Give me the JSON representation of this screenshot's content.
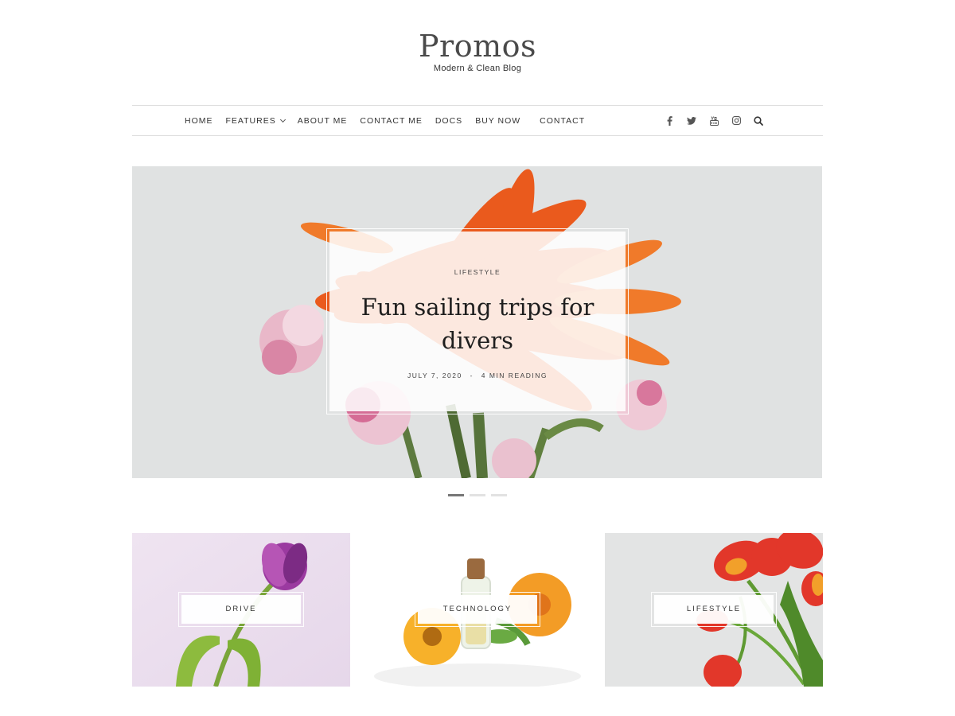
{
  "site": {
    "title": "Promos",
    "tagline": "Modern & Clean Blog"
  },
  "nav": {
    "items": [
      {
        "label": "HOME"
      },
      {
        "label": "FEATURES"
      },
      {
        "label": "ABOUT ME"
      },
      {
        "label": "CONTACT ME"
      },
      {
        "label": "DOCS"
      },
      {
        "label": "BUY NOW"
      },
      {
        "label": "CONTACT"
      }
    ],
    "social_icons": [
      "facebook-icon",
      "twitter-icon",
      "youtube-icon",
      "instagram-icon",
      "search-icon"
    ]
  },
  "hero": {
    "category": "LIFESTYLE",
    "title": "Fun sailing trips for divers",
    "date": "JULY 7, 2020",
    "separator": "-",
    "reading": "4 MIN READING",
    "slides_total": 3,
    "active_slide": 1
  },
  "categories": [
    {
      "label": "DRIVE"
    },
    {
      "label": "TECHNOLOGY"
    },
    {
      "label": "LIFESTYLE"
    }
  ],
  "colors": {
    "text": "#333333",
    "divider": "#dedede",
    "dot_active": "#777777",
    "dot_inactive": "#e2e2e2"
  }
}
